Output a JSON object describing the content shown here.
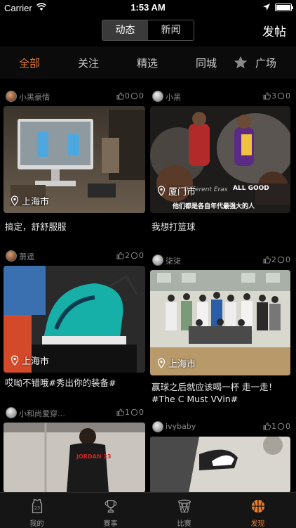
{
  "status_bar": {
    "carrier": "Carrier",
    "time": "1:53 AM"
  },
  "nav": {
    "segments": [
      "动态",
      "新闻"
    ],
    "active_segment": "动态",
    "post_label": "发帖"
  },
  "filters": {
    "items": [
      "全部",
      "关注",
      "精选",
      "同城",
      "广场"
    ],
    "active": "全部"
  },
  "cards": [
    {
      "user": "小黑豪情",
      "likes": "0",
      "comments": "0",
      "location": "上海市",
      "caption": "搞定，舒舒服服",
      "image": "desk-computer-photo"
    },
    {
      "user": "小黑",
      "likes": "3",
      "comments": "0",
      "location": "厦门市",
      "caption": "我想打篮球",
      "image": "basketball-poster-photo",
      "poster_top_text": "ALL GOOD",
      "poster_mid_text": "Different Eras",
      "poster_bottom_text": "他们都是各自年代最强大的人"
    },
    {
      "user": "萧遥",
      "likes": "2",
      "comments": "0",
      "location": "上海市",
      "caption": "哎呦不错哦#秀出你的装备#",
      "image": "sneaker-photo"
    },
    {
      "user": "柒柒",
      "likes": "2",
      "comments": "0",
      "location": "上海市",
      "caption": "赢球之后就应该喝一杯 走一走！#The C Must VVin#",
      "image": "team-photo"
    },
    {
      "user": "小和尚爱穿…",
      "likes": "1",
      "comments": "0",
      "image": "jersey-photo",
      "jersey_text": "JORDAN 23"
    },
    {
      "user": "ivybaby",
      "likes": "1",
      "comments": "0",
      "image": "sneaker-floor-photo"
    }
  ],
  "tabs": [
    {
      "label": "我的",
      "icon": "jersey-icon"
    },
    {
      "label": "赛事",
      "icon": "trophy-icon"
    },
    {
      "label": "比赛",
      "icon": "hoop-icon"
    },
    {
      "label": "发现",
      "icon": "basketball-icon"
    }
  ],
  "active_tab": "发现",
  "colors": {
    "accent": "#e87c2c",
    "background": "#000000",
    "tabbar": "#151515"
  }
}
